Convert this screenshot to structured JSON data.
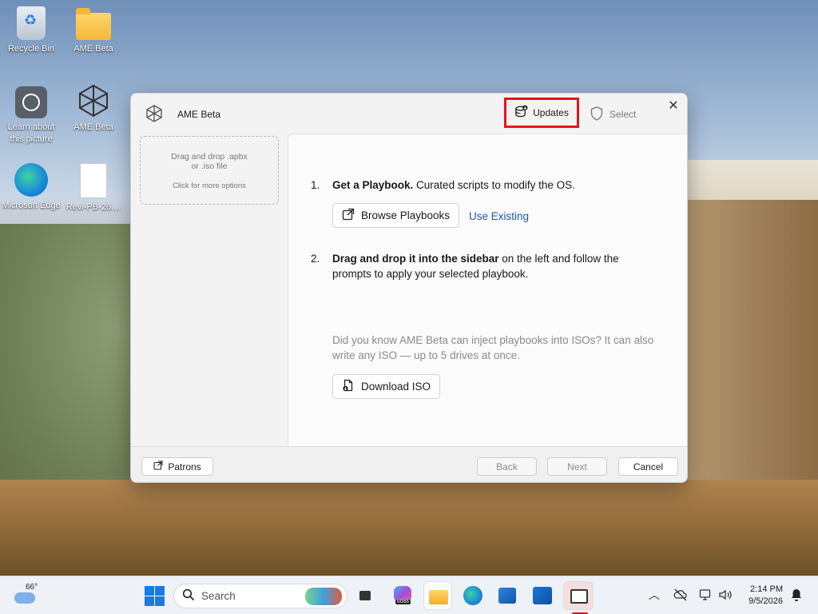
{
  "desktop": {
    "icons": [
      {
        "label": "Recycle Bin"
      },
      {
        "label": "AME Beta"
      },
      {
        "label": "Learn about this picture"
      },
      {
        "label": "AME Beta"
      },
      {
        "label": "Microsoft Edge"
      },
      {
        "label": "Revi-PB-26...."
      }
    ]
  },
  "dialog": {
    "title": "AME Beta",
    "updates_label": "Updates",
    "select_label": "Select",
    "close_glyph": "✕",
    "dropzone": {
      "line1": "Drag and drop .apbx",
      "line2": "or .iso file",
      "line3": "Click for more options"
    },
    "steps": [
      {
        "number": "1.",
        "bold": "Get a Playbook.",
        "rest": " Curated scripts to modify the OS."
      },
      {
        "number": "2.",
        "bold": "Drag and drop it into the sidebar",
        "rest": " on the left and follow the prompts to apply your selected playbook."
      }
    ],
    "browse_label": "Browse Playbooks",
    "use_existing_label": "Use Existing",
    "iso_hint": "Did you know AME Beta can inject playbooks into ISOs? It can also write any ISO — up to 5 drives at once.",
    "download_iso_label": "Download ISO",
    "footer": {
      "patrons_label": "Patrons",
      "back_label": "Back",
      "next_label": "Next",
      "cancel_label": "Cancel"
    }
  },
  "taskbar": {
    "temperature": "66°",
    "search_placeholder": "Search",
    "time": "2:14 PM",
    "date": "9/5/2026",
    "m365_badge": "M365"
  },
  "colors": {
    "highlight_border": "#e3141c",
    "link": "#1a5bb0",
    "active_app_indicator": "#d11c24"
  }
}
